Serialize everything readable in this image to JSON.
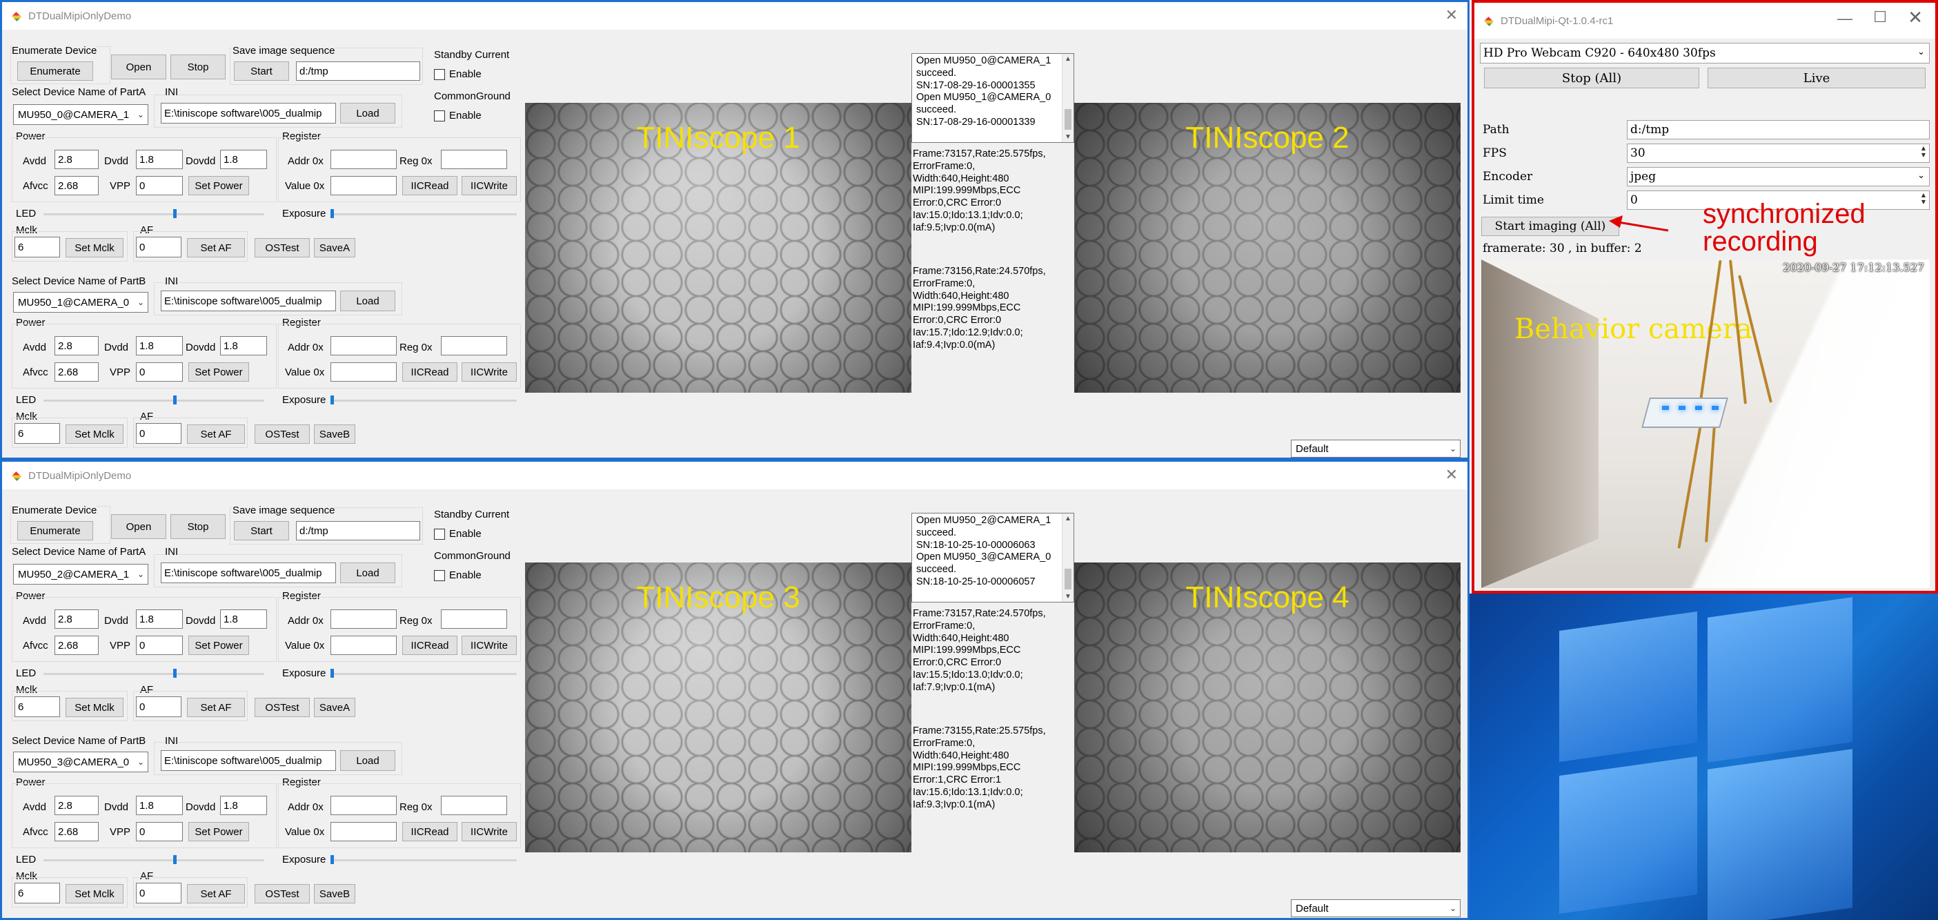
{
  "windows": [
    {
      "title": "DTDualMipiOnlyDemo",
      "enumerate_group": "Enumerate Device",
      "enumerate_btn": "Enumerate",
      "open_btn": "Open",
      "stop_btn": "Stop",
      "save_seq_label": "Save image sequence",
      "start_btn": "Start",
      "save_path": "d:/tmp",
      "standby_label": "Standby Current",
      "enable1": "Enable",
      "common_ground": "CommonGround",
      "enable2": "Enable",
      "partA_label": "Select Device Name of PartA",
      "partA_device": "MU950_0@CAMERA_1",
      "partA_ini_label": "INI",
      "partA_ini": "E:\\tiniscope software\\005_dualmip",
      "load_btn": "Load",
      "partA": {
        "power": "Power",
        "avdd_l": "Avdd",
        "avdd": "2.8",
        "dvdd_l": "Dvdd",
        "dvdd": "1.8",
        "dovdd_l": "Dovdd",
        "dovdd": "1.8",
        "afvcc_l": "Afvcc",
        "afvcc": "2.68",
        "vpp_l": "VPP",
        "vpp": "0",
        "set_power": "Set Power",
        "register": "Register",
        "addr_l": "Addr 0x",
        "reg_l": "Reg 0x",
        "value_l": "Value 0x",
        "iicread": "IICRead",
        "iicwrite": "IICWrite",
        "led": "LED",
        "exposure": "Exposure",
        "mclk_l": "Mclk",
        "mclk": "6",
        "set_mclk": "Set Mclk",
        "af_l": "AF",
        "af": "0",
        "set_af": "Set AF",
        "ostest": "OSTest",
        "save": "SaveA"
      },
      "partB_label": "Select Device Name of PartB",
      "partB_device": "MU950_1@CAMERA_0",
      "partB_ini_label": "INI",
      "partB_ini": "E:\\tiniscope software\\005_dualmip",
      "partB": {
        "power": "Power",
        "avdd_l": "Avdd",
        "avdd": "2.8",
        "dvdd_l": "Dvdd",
        "dvdd": "1.8",
        "dovdd_l": "Dovdd",
        "dovdd": "1.8",
        "afvcc_l": "Afvcc",
        "afvcc": "2.68",
        "vpp_l": "VPP",
        "vpp": "0",
        "set_power": "Set Power",
        "register": "Register",
        "addr_l": "Addr 0x",
        "reg_l": "Reg 0x",
        "value_l": "Value 0x",
        "iicread": "IICRead",
        "iicwrite": "IICWrite",
        "led": "LED",
        "exposure": "Exposure",
        "mclk_l": "Mclk",
        "mclk": "6",
        "set_mclk": "Set Mclk",
        "af_l": "AF",
        "af": "0",
        "set_af": "Set AF",
        "ostest": "OSTest",
        "save": "SaveB"
      },
      "video1_label": "TINIscope 1",
      "video2_label": "TINIscope 2",
      "log_open": "Open MU950_0@CAMERA_1\nsucceed.\nSN:17-08-29-16-00001355\nOpen MU950_1@CAMERA_0\nsucceed.\nSN:17-08-29-16-00001339",
      "stats1": "Frame:73157,Rate:25.575fps,\nErrorFrame:0,\nWidth:640,Height:480\nMIPI:199.999Mbps,ECC\nError:0,CRC Error:0\nIav:15.0;Ido:13.1;Idv:0.0;\nIaf:9.5;Ivp:0.0(mA)",
      "stats2": "Frame:73156,Rate:24.570fps,\nErrorFrame:0,\nWidth:640,Height:480\nMIPI:199.999Mbps,ECC\nError:0,CRC Error:0\nIav:15.7;Ido:12.9;Idv:0.0;\nIaf:9.4;Ivp:0.0(mA)",
      "default_combo": "Default"
    },
    {
      "title": "DTDualMipiOnlyDemo",
      "enumerate_group": "Enumerate Device",
      "enumerate_btn": "Enumerate",
      "open_btn": "Open",
      "stop_btn": "Stop",
      "save_seq_label": "Save image sequence",
      "start_btn": "Start",
      "save_path": "d:/tmp",
      "standby_label": "Standby Current",
      "enable1": "Enable",
      "common_ground": "CommonGround",
      "enable2": "Enable",
      "partA_label": "Select Device Name of PartA",
      "partA_device": "MU950_2@CAMERA_1",
      "partA_ini_label": "INI",
      "partA_ini": "E:\\tiniscope software\\005_dualmip",
      "load_btn": "Load",
      "partA": {
        "power": "Power",
        "avdd_l": "Avdd",
        "avdd": "2.8",
        "dvdd_l": "Dvdd",
        "dvdd": "1.8",
        "dovdd_l": "Dovdd",
        "dovdd": "1.8",
        "afvcc_l": "Afvcc",
        "afvcc": "2.68",
        "vpp_l": "VPP",
        "vpp": "0",
        "set_power": "Set Power",
        "register": "Register",
        "addr_l": "Addr 0x",
        "reg_l": "Reg 0x",
        "value_l": "Value 0x",
        "iicread": "IICRead",
        "iicwrite": "IICWrite",
        "led": "LED",
        "exposure": "Exposure",
        "mclk_l": "Mclk",
        "mclk": "6",
        "set_mclk": "Set Mclk",
        "af_l": "AF",
        "af": "0",
        "set_af": "Set AF",
        "ostest": "OSTest",
        "save": "SaveA"
      },
      "partB_label": "Select Device Name of PartB",
      "partB_device": "MU950_3@CAMERA_0",
      "partB_ini_label": "INI",
      "partB_ini": "E:\\tiniscope software\\005_dualmip",
      "partB": {
        "power": "Power",
        "avdd_l": "Avdd",
        "avdd": "2.8",
        "dvdd_l": "Dvdd",
        "dvdd": "1.8",
        "dovdd_l": "Dovdd",
        "dovdd": "1.8",
        "afvcc_l": "Afvcc",
        "afvcc": "2.68",
        "vpp_l": "VPP",
        "vpp": "0",
        "set_power": "Set Power",
        "register": "Register",
        "addr_l": "Addr 0x",
        "reg_l": "Reg 0x",
        "value_l": "Value 0x",
        "iicread": "IICRead",
        "iicwrite": "IICWrite",
        "led": "LED",
        "exposure": "Exposure",
        "mclk_l": "Mclk",
        "mclk": "6",
        "set_mclk": "Set Mclk",
        "af_l": "AF",
        "af": "0",
        "set_af": "Set AF",
        "ostest": "OSTest",
        "save": "SaveB"
      },
      "video1_label": "TINIscope 3",
      "video2_label": "TINIscope 4",
      "log_open": "Open MU950_2@CAMERA_1\nsucceed.\nSN:18-10-25-10-00006063\nOpen MU950_3@CAMERA_0\nsucceed.\nSN:18-10-25-10-00006057",
      "stats1": "Frame:73157,Rate:24.570fps,\nErrorFrame:0,\nWidth:640,Height:480\nMIPI:199.999Mbps,ECC\nError:0,CRC Error:0\nIav:15.5;Ido:13.0;Idv:0.0;\nIaf:7.9;Ivp:0.1(mA)",
      "stats2": "Frame:73155,Rate:25.575fps,\nErrorFrame:0,\nWidth:640,Height:480\nMIPI:199.999Mbps,ECC\nError:1,CRC Error:1\nIav:15.6;Ido:13.1;Idv:0.0;\nIaf:9.3;Ivp:0.1(mA)",
      "default_combo": "Default"
    }
  ],
  "qt": {
    "title": "DTDualMipi-Qt-1.0.4-rc1",
    "camera": "HD Pro Webcam C920 - 640x480 30fps",
    "stop_btn": "Stop (All)",
    "live_btn": "Live",
    "path_l": "Path",
    "path": "d:/tmp",
    "fps_l": "FPS",
    "fps": "30",
    "encoder_l": "Encoder",
    "encoder": "jpeg",
    "limit_l": "Limit time",
    "limit": "0",
    "start_btn": "Start imaging (All)",
    "status": "framerate: 30 , in buffer: 2",
    "timestamp": "2020-09-27 17:12:13.527",
    "behavior_label": "Behavior camera",
    "annotation_line1": "synchronized",
    "annotation_line2": "recording"
  },
  "colors": {
    "blue_frame": "#1f6fd1",
    "red_frame": "#e00000",
    "label_yellow": "#f5e000"
  }
}
